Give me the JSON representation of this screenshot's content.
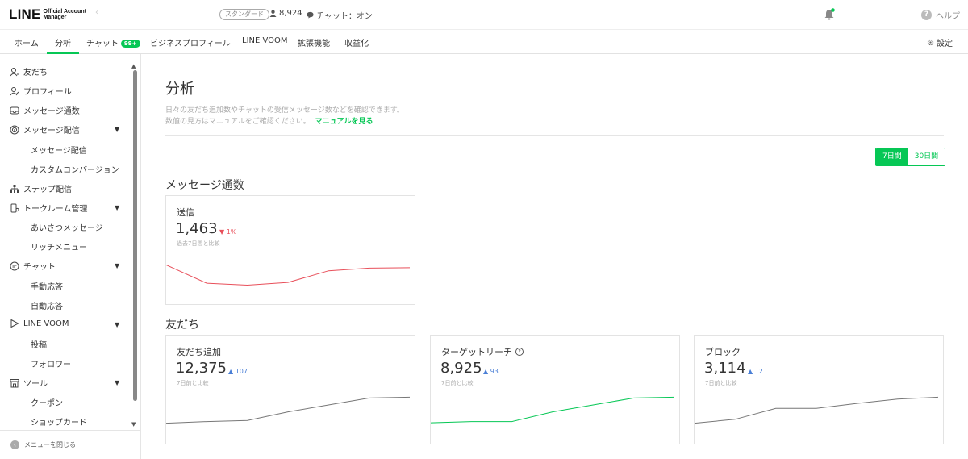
{
  "header": {
    "logo_main": "LINE",
    "logo_sub_1": "Official Account",
    "logo_sub_2": "Manager",
    "plan": "スタンダード",
    "friend_count": "8,924",
    "chat_status": "チャット：オン",
    "help": "ヘルプ"
  },
  "nav": {
    "tabs": [
      {
        "label": "ホーム"
      },
      {
        "label": "分析"
      },
      {
        "label": "チャット"
      },
      {
        "label": "ビジネスプロフィール"
      },
      {
        "label": "LINE VOOM"
      },
      {
        "label": "拡張機能"
      },
      {
        "label": "収益化"
      }
    ],
    "chat_badge": "99+",
    "settings": "設定"
  },
  "sidebar": {
    "items": [
      {
        "label": "友だち"
      },
      {
        "label": "プロフィール"
      },
      {
        "label": "メッセージ通数"
      },
      {
        "label": "メッセージ配信"
      },
      {
        "label": "メッセージ配信"
      },
      {
        "label": "カスタムコンバージョン"
      },
      {
        "label": "ステップ配信"
      },
      {
        "label": "トークルーム管理"
      },
      {
        "label": "あいさつメッセージ"
      },
      {
        "label": "リッチメニュー"
      },
      {
        "label": "チャット"
      },
      {
        "label": "手動応答"
      },
      {
        "label": "自動応答"
      },
      {
        "label": "LINE VOOM"
      },
      {
        "label": "投稿"
      },
      {
        "label": "フォロワー"
      },
      {
        "label": "ツール"
      },
      {
        "label": "クーポン"
      },
      {
        "label": "ショップカード"
      }
    ],
    "close_menu": "メニューを閉じる"
  },
  "main": {
    "title": "分析",
    "desc_line1": "日々の友だち追加数やチャットの受信メッセージ数などを確認できます。",
    "desc_line2": "数値の見方はマニュアルをご確認ください。",
    "manual_link": "マニュアルを見る",
    "period_7": "7日間",
    "period_30": "30日間",
    "section_messages": "メッセージ通数",
    "section_friends": "友だち",
    "cards": {
      "sent": {
        "label": "送信",
        "value": "1,463",
        "delta": "1%",
        "compare": "過去7日間と比較",
        "color": "#e8505b",
        "trend": [
          0.76,
          0.29,
          0.24,
          0.31,
          0.61,
          0.68,
          0.69
        ]
      },
      "friends_added": {
        "label": "友だち追加",
        "value": "12,375",
        "delta": "107",
        "compare": "7日前と比較",
        "color": "#777777",
        "trend": [
          0.28,
          0.32,
          0.35,
          0.57,
          0.75,
          0.93,
          0.95
        ]
      },
      "target_reach": {
        "label": "ターゲットリーチ",
        "value": "8,925",
        "delta": "93",
        "compare": "7日前と比較",
        "color": "#06c755",
        "trend": [
          0.29,
          0.32,
          0.32,
          0.57,
          0.75,
          0.93,
          0.95
        ]
      },
      "blocks": {
        "label": "ブロック",
        "value": "3,114",
        "delta": "12",
        "compare": "7日前と比較",
        "color": "#777777",
        "trend": [
          0.28,
          0.38,
          0.66,
          0.66,
          0.79,
          0.9,
          0.95
        ]
      }
    }
  }
}
